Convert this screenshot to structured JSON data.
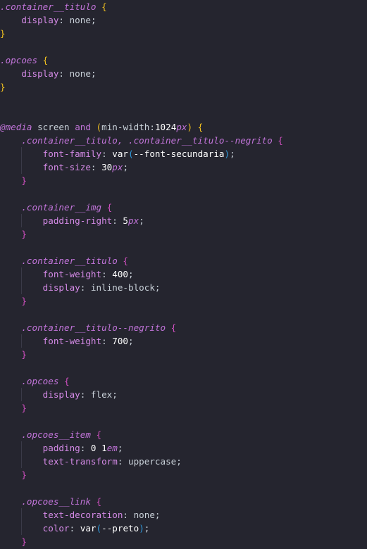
{
  "editor": {
    "language": "css",
    "colors": {
      "background": "#25252f",
      "selector": "#c174d9",
      "property": "#d48ae6",
      "value": "#c9d1d9",
      "number": "#ffffff",
      "brace_top": "#f0c020",
      "brace_nested": "#d050c0",
      "paren_inner": "#2f9bdf"
    },
    "rules": [
      {
        "selector": ".container__titulo",
        "declarations": [
          {
            "property": "display",
            "value": "none"
          }
        ]
      },
      {
        "selector": ".opcoes",
        "declarations": [
          {
            "property": "display",
            "value": "none"
          }
        ]
      }
    ],
    "media": {
      "at": "@media",
      "type": "screen",
      "and": "and",
      "feature": "min-width",
      "feature_value_num": "1024",
      "feature_value_unit": "px",
      "rules": [
        {
          "selector": ".container__titulo, .container__titulo--negrito",
          "declarations": [
            {
              "property": "font-family",
              "fn": "var",
              "arg": "--font-secundaria"
            },
            {
              "property": "font-size",
              "num": "30",
              "unit": "px"
            }
          ]
        },
        {
          "selector": ".container__img",
          "declarations": [
            {
              "property": "padding-right",
              "num": "5",
              "unit": "px"
            }
          ]
        },
        {
          "selector": ".container__titulo",
          "declarations": [
            {
              "property": "font-weight",
              "num": "400"
            },
            {
              "property": "display",
              "value": "inline-block"
            }
          ]
        },
        {
          "selector": ".container__titulo--negrito",
          "declarations": [
            {
              "property": "font-weight",
              "num": "700"
            }
          ]
        },
        {
          "selector": ".opcoes",
          "declarations": [
            {
              "property": "display",
              "value": "flex"
            }
          ]
        },
        {
          "selector": ".opcoes__item",
          "declarations": [
            {
              "property": "padding",
              "num_a": "0",
              "num_b": "1",
              "unit": "em"
            },
            {
              "property": "text-transform",
              "value": "uppercase"
            }
          ]
        },
        {
          "selector": ".opcoes__link",
          "declarations": [
            {
              "property": "text-decoration",
              "value": "none"
            },
            {
              "property": "color",
              "fn": "var",
              "arg": "--preto"
            }
          ]
        }
      ]
    }
  }
}
